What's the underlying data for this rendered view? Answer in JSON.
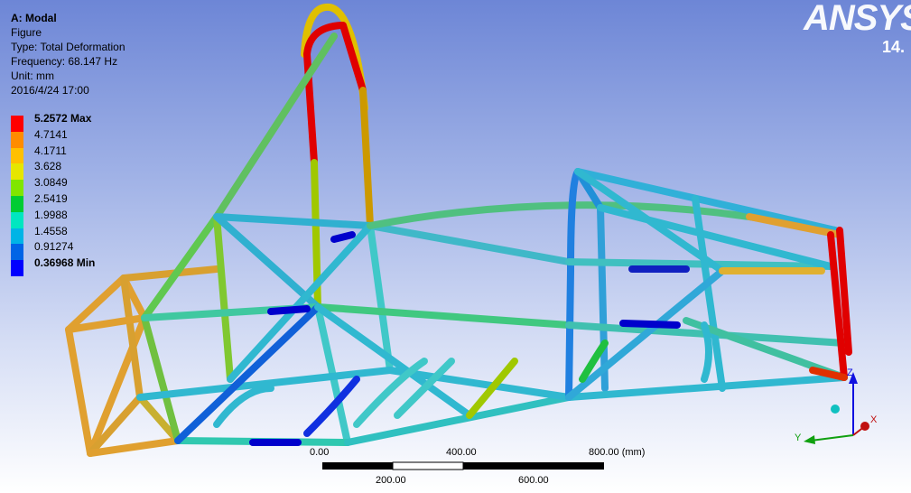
{
  "header": {
    "title": "A: Modal",
    "subtitle": "Figure",
    "type": "Type: Total Deformation",
    "frequency": "Frequency: 68.147 Hz",
    "unit": "Unit: mm",
    "date": "2016/4/24 17:00"
  },
  "legend": {
    "entries": [
      {
        "label": "5.2572 Max",
        "color": "#ff0000",
        "bold": true
      },
      {
        "label": "4.7141",
        "color": "#ff8c00",
        "bold": false
      },
      {
        "label": "4.1711",
        "color": "#ffc000",
        "bold": false
      },
      {
        "label": "3.628",
        "color": "#e6e600",
        "bold": false
      },
      {
        "label": "3.0849",
        "color": "#80e600",
        "bold": false
      },
      {
        "label": "2.5419",
        "color": "#00cc33",
        "bold": false
      },
      {
        "label": "1.9988",
        "color": "#00e6c0",
        "bold": false
      },
      {
        "label": "1.4558",
        "color": "#00b4e6",
        "bold": false
      },
      {
        "label": "0.91274",
        "color": "#0064e6",
        "bold": false
      },
      {
        "label": "0.36968 Min",
        "color": "#0000ff",
        "bold": true
      }
    ]
  },
  "branding": {
    "logo": "ANSYS",
    "version": "14."
  },
  "scale_bar": {
    "top_labels": [
      "0.00",
      "400.00",
      "800.00 (mm)"
    ],
    "bottom_labels": [
      "200.00",
      "600.00"
    ]
  },
  "triad": {
    "x_label": "X",
    "y_label": "Y",
    "z_label": "Z"
  },
  "colors": {
    "background_top": "#6d86d6",
    "background_bottom": "#ffffff"
  }
}
